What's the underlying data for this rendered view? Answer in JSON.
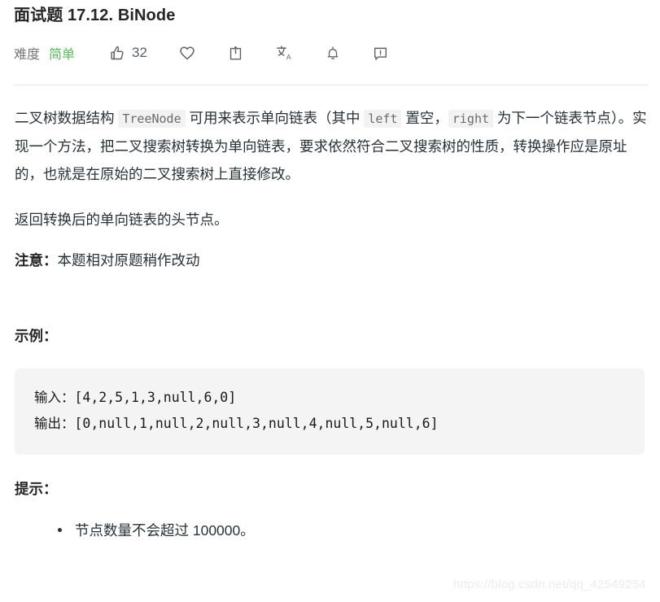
{
  "header": {
    "title": "面试题 17.12. BiNode",
    "difficulty_label": "难度",
    "difficulty_value": "简单",
    "difficulty_color": "#5cb85c",
    "like_count": "32",
    "icons": {
      "thumbs_up": "thumbs-up-icon",
      "heart": "heart-icon",
      "share": "share-icon",
      "translate": "translate-icon",
      "bell": "bell-icon",
      "report": "report-icon"
    }
  },
  "body": {
    "paragraph1": {
      "t1": "二叉树数据结构 ",
      "code1": "TreeNode",
      "t2": " 可用来表示单向链表（其中 ",
      "code2": "left",
      "t3": " 置空，",
      "code3": "right",
      "t4": " 为下一个链表节点）。实现一个方法，把二叉搜索树转换为单向链表，要求依然符合二叉搜索树的性质，转换操作应是原址的，也就是在原始的二叉搜索树上直接修改。"
    },
    "paragraph2": "返回转换后的单向链表的头节点。",
    "note_label": "注意：",
    "note_text": "本题相对原题稍作改动",
    "example_heading": "示例：",
    "code_block": {
      "input_label": "输入：",
      "input_value": "[4,2,5,1,3,null,6,0]",
      "output_label": "输出：",
      "output_value": "[0,null,1,null,2,null,3,null,4,null,5,null,6]"
    },
    "hints_heading": "提示：",
    "hints": [
      "节点数量不会超过 100000。"
    ]
  },
  "watermark": "https://blog.csdn.net/qq_42549254"
}
